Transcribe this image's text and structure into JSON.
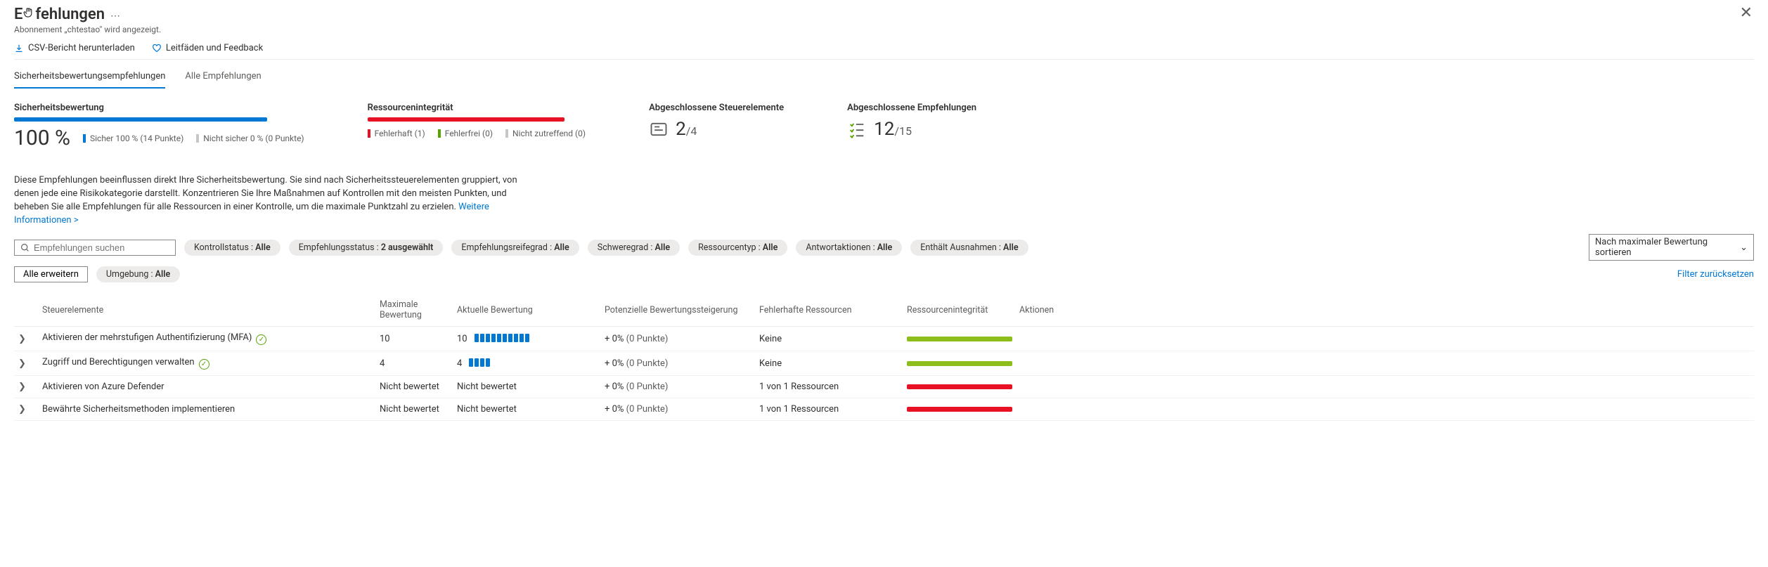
{
  "header": {
    "title_prefix": "E",
    "title_suffix": "fehlungen",
    "subtitle": "Abonnement „chtestao\" wird angezeigt."
  },
  "toolbar": {
    "csv": "CSV-Bericht herunterladen",
    "feedback": "Leitfäden und Feedback"
  },
  "tabs": {
    "t1": "Sicherheitsbewertungsempfehlungen",
    "t2": "Alle Empfehlungen"
  },
  "stats": {
    "score_label": "Sicherheitsbewertung",
    "score_value": "100 %",
    "legend_secure": "Sicher 100 % (14 Punkte)",
    "legend_unsecure": "Nicht sicher 0 % (0 Punkte)",
    "integrity_label": "Ressourcenintegrität",
    "legend_faulty": "Fehlerhaft (1)",
    "legend_ok": "Fehlerfrei (0)",
    "legend_na": "Nicht zutreffend (0)",
    "controls_label": "Abgeschlossene Steuerelemente",
    "controls_num": "2",
    "controls_den": "/4",
    "recs_label": "Abgeschlossene Empfehlungen",
    "recs_num": "12",
    "recs_den": "/15"
  },
  "desc": {
    "text": "Diese Empfehlungen beeinflussen direkt Ihre Sicherheitsbewertung. Sie sind nach Sicherheitssteuerelementen gruppiert, von denen jede eine Risikokategorie darstellt. Konzentrieren Sie Ihre Maßnahmen auf Kontrollen mit den meisten Punkten, und beheben Sie alle Empfehlungen für alle Ressourcen in einer Kontrolle, um die maximale Punktzahl zu erzielen. ",
    "link": "Weitere Informationen >"
  },
  "filters": {
    "search_placeholder": "Empfehlungen suchen",
    "f1_label": "Kontrollstatus : ",
    "f1_value": "Alle",
    "f2_label": "Empfehlungsstatus : ",
    "f2_value": "2 ausgewählt",
    "f3_label": "Empfehlungsreifegrad : ",
    "f3_value": "Alle",
    "f4_label": "Schweregrad : ",
    "f4_value": "Alle",
    "f5_label": "Ressourcentyp : ",
    "f5_value": "Alle",
    "f6_label": "Antwortaktionen : ",
    "f6_value": "Alle",
    "f7_label": "Enthält Ausnahmen : ",
    "f7_value": "Alle",
    "f8_label": "Umgebung : ",
    "f8_value": "Alle",
    "sort": "Nach maximaler Bewertung sortieren",
    "expand_all": "Alle erweitern",
    "reset": "Filter zurücksetzen"
  },
  "table": {
    "h_name": "Steuerelemente",
    "h_max": "Maximale Bewertung",
    "h_cur": "Aktuelle Bewertung",
    "h_pot": "Potenzielle Bewertungssteigerung",
    "h_bad": "Fehlerhafte Ressourcen",
    "h_int": "Ressourcenintegrität",
    "h_act": "Aktionen",
    "r1_name": "Aktivieren der mehrstufigen Authentifizierung (MFA)",
    "r1_max": "10",
    "r1_cur": "10",
    "r1_pot_a": "+ 0%",
    "r1_pot_b": " (0 Punkte)",
    "r1_bad": "Keine",
    "r2_name": "Zugriff und Berechtigungen verwalten",
    "r2_max": "4",
    "r2_cur": "4",
    "r2_pot_a": "+ 0%",
    "r2_pot_b": " (0 Punkte)",
    "r2_bad": "Keine",
    "r3_name": "Aktivieren von Azure Defender",
    "r3_max": "Nicht bewertet",
    "r3_cur": "Nicht bewertet",
    "r3_pot_a": "+ 0%",
    "r3_pot_b": " (0 Punkte)",
    "r3_bad": "1 von 1 Ressourcen",
    "r4_name": "Bewährte Sicherheitsmethoden implementieren",
    "r4_max": "Nicht bewertet",
    "r4_cur": "Nicht bewertet",
    "r4_pot_a": "+ 0%",
    "r4_pot_b": " (0 Punkte)",
    "r4_bad": "1 von 1 Ressourcen"
  }
}
